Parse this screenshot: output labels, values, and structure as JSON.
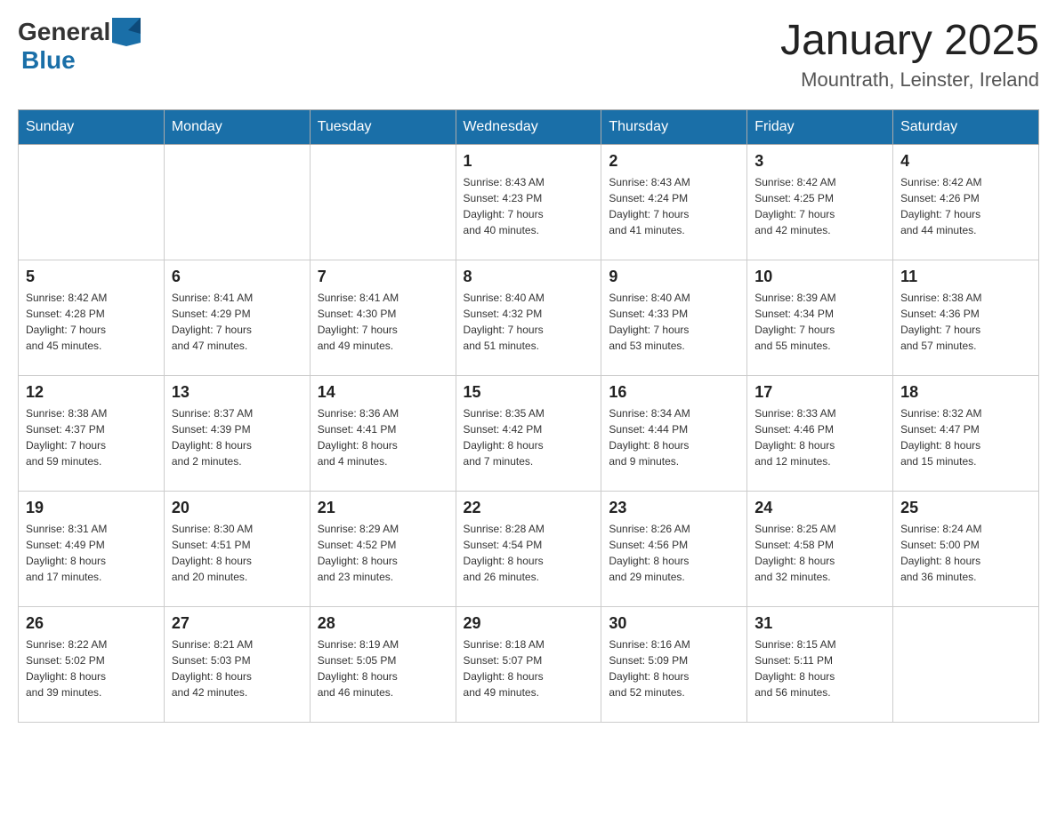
{
  "header": {
    "logo": {
      "general": "General",
      "blue": "Blue"
    },
    "title": "January 2025",
    "location": "Mountrath, Leinster, Ireland"
  },
  "weekdays": [
    "Sunday",
    "Monday",
    "Tuesday",
    "Wednesday",
    "Thursday",
    "Friday",
    "Saturday"
  ],
  "weeks": [
    [
      {
        "day": "",
        "info": ""
      },
      {
        "day": "",
        "info": ""
      },
      {
        "day": "",
        "info": ""
      },
      {
        "day": "1",
        "info": "Sunrise: 8:43 AM\nSunset: 4:23 PM\nDaylight: 7 hours\nand 40 minutes."
      },
      {
        "day": "2",
        "info": "Sunrise: 8:43 AM\nSunset: 4:24 PM\nDaylight: 7 hours\nand 41 minutes."
      },
      {
        "day": "3",
        "info": "Sunrise: 8:42 AM\nSunset: 4:25 PM\nDaylight: 7 hours\nand 42 minutes."
      },
      {
        "day": "4",
        "info": "Sunrise: 8:42 AM\nSunset: 4:26 PM\nDaylight: 7 hours\nand 44 minutes."
      }
    ],
    [
      {
        "day": "5",
        "info": "Sunrise: 8:42 AM\nSunset: 4:28 PM\nDaylight: 7 hours\nand 45 minutes."
      },
      {
        "day": "6",
        "info": "Sunrise: 8:41 AM\nSunset: 4:29 PM\nDaylight: 7 hours\nand 47 minutes."
      },
      {
        "day": "7",
        "info": "Sunrise: 8:41 AM\nSunset: 4:30 PM\nDaylight: 7 hours\nand 49 minutes."
      },
      {
        "day": "8",
        "info": "Sunrise: 8:40 AM\nSunset: 4:32 PM\nDaylight: 7 hours\nand 51 minutes."
      },
      {
        "day": "9",
        "info": "Sunrise: 8:40 AM\nSunset: 4:33 PM\nDaylight: 7 hours\nand 53 minutes."
      },
      {
        "day": "10",
        "info": "Sunrise: 8:39 AM\nSunset: 4:34 PM\nDaylight: 7 hours\nand 55 minutes."
      },
      {
        "day": "11",
        "info": "Sunrise: 8:38 AM\nSunset: 4:36 PM\nDaylight: 7 hours\nand 57 minutes."
      }
    ],
    [
      {
        "day": "12",
        "info": "Sunrise: 8:38 AM\nSunset: 4:37 PM\nDaylight: 7 hours\nand 59 minutes."
      },
      {
        "day": "13",
        "info": "Sunrise: 8:37 AM\nSunset: 4:39 PM\nDaylight: 8 hours\nand 2 minutes."
      },
      {
        "day": "14",
        "info": "Sunrise: 8:36 AM\nSunset: 4:41 PM\nDaylight: 8 hours\nand 4 minutes."
      },
      {
        "day": "15",
        "info": "Sunrise: 8:35 AM\nSunset: 4:42 PM\nDaylight: 8 hours\nand 7 minutes."
      },
      {
        "day": "16",
        "info": "Sunrise: 8:34 AM\nSunset: 4:44 PM\nDaylight: 8 hours\nand 9 minutes."
      },
      {
        "day": "17",
        "info": "Sunrise: 8:33 AM\nSunset: 4:46 PM\nDaylight: 8 hours\nand 12 minutes."
      },
      {
        "day": "18",
        "info": "Sunrise: 8:32 AM\nSunset: 4:47 PM\nDaylight: 8 hours\nand 15 minutes."
      }
    ],
    [
      {
        "day": "19",
        "info": "Sunrise: 8:31 AM\nSunset: 4:49 PM\nDaylight: 8 hours\nand 17 minutes."
      },
      {
        "day": "20",
        "info": "Sunrise: 8:30 AM\nSunset: 4:51 PM\nDaylight: 8 hours\nand 20 minutes."
      },
      {
        "day": "21",
        "info": "Sunrise: 8:29 AM\nSunset: 4:52 PM\nDaylight: 8 hours\nand 23 minutes."
      },
      {
        "day": "22",
        "info": "Sunrise: 8:28 AM\nSunset: 4:54 PM\nDaylight: 8 hours\nand 26 minutes."
      },
      {
        "day": "23",
        "info": "Sunrise: 8:26 AM\nSunset: 4:56 PM\nDaylight: 8 hours\nand 29 minutes."
      },
      {
        "day": "24",
        "info": "Sunrise: 8:25 AM\nSunset: 4:58 PM\nDaylight: 8 hours\nand 32 minutes."
      },
      {
        "day": "25",
        "info": "Sunrise: 8:24 AM\nSunset: 5:00 PM\nDaylight: 8 hours\nand 36 minutes."
      }
    ],
    [
      {
        "day": "26",
        "info": "Sunrise: 8:22 AM\nSunset: 5:02 PM\nDaylight: 8 hours\nand 39 minutes."
      },
      {
        "day": "27",
        "info": "Sunrise: 8:21 AM\nSunset: 5:03 PM\nDaylight: 8 hours\nand 42 minutes."
      },
      {
        "day": "28",
        "info": "Sunrise: 8:19 AM\nSunset: 5:05 PM\nDaylight: 8 hours\nand 46 minutes."
      },
      {
        "day": "29",
        "info": "Sunrise: 8:18 AM\nSunset: 5:07 PM\nDaylight: 8 hours\nand 49 minutes."
      },
      {
        "day": "30",
        "info": "Sunrise: 8:16 AM\nSunset: 5:09 PM\nDaylight: 8 hours\nand 52 minutes."
      },
      {
        "day": "31",
        "info": "Sunrise: 8:15 AM\nSunset: 5:11 PM\nDaylight: 8 hours\nand 56 minutes."
      },
      {
        "day": "",
        "info": ""
      }
    ]
  ]
}
